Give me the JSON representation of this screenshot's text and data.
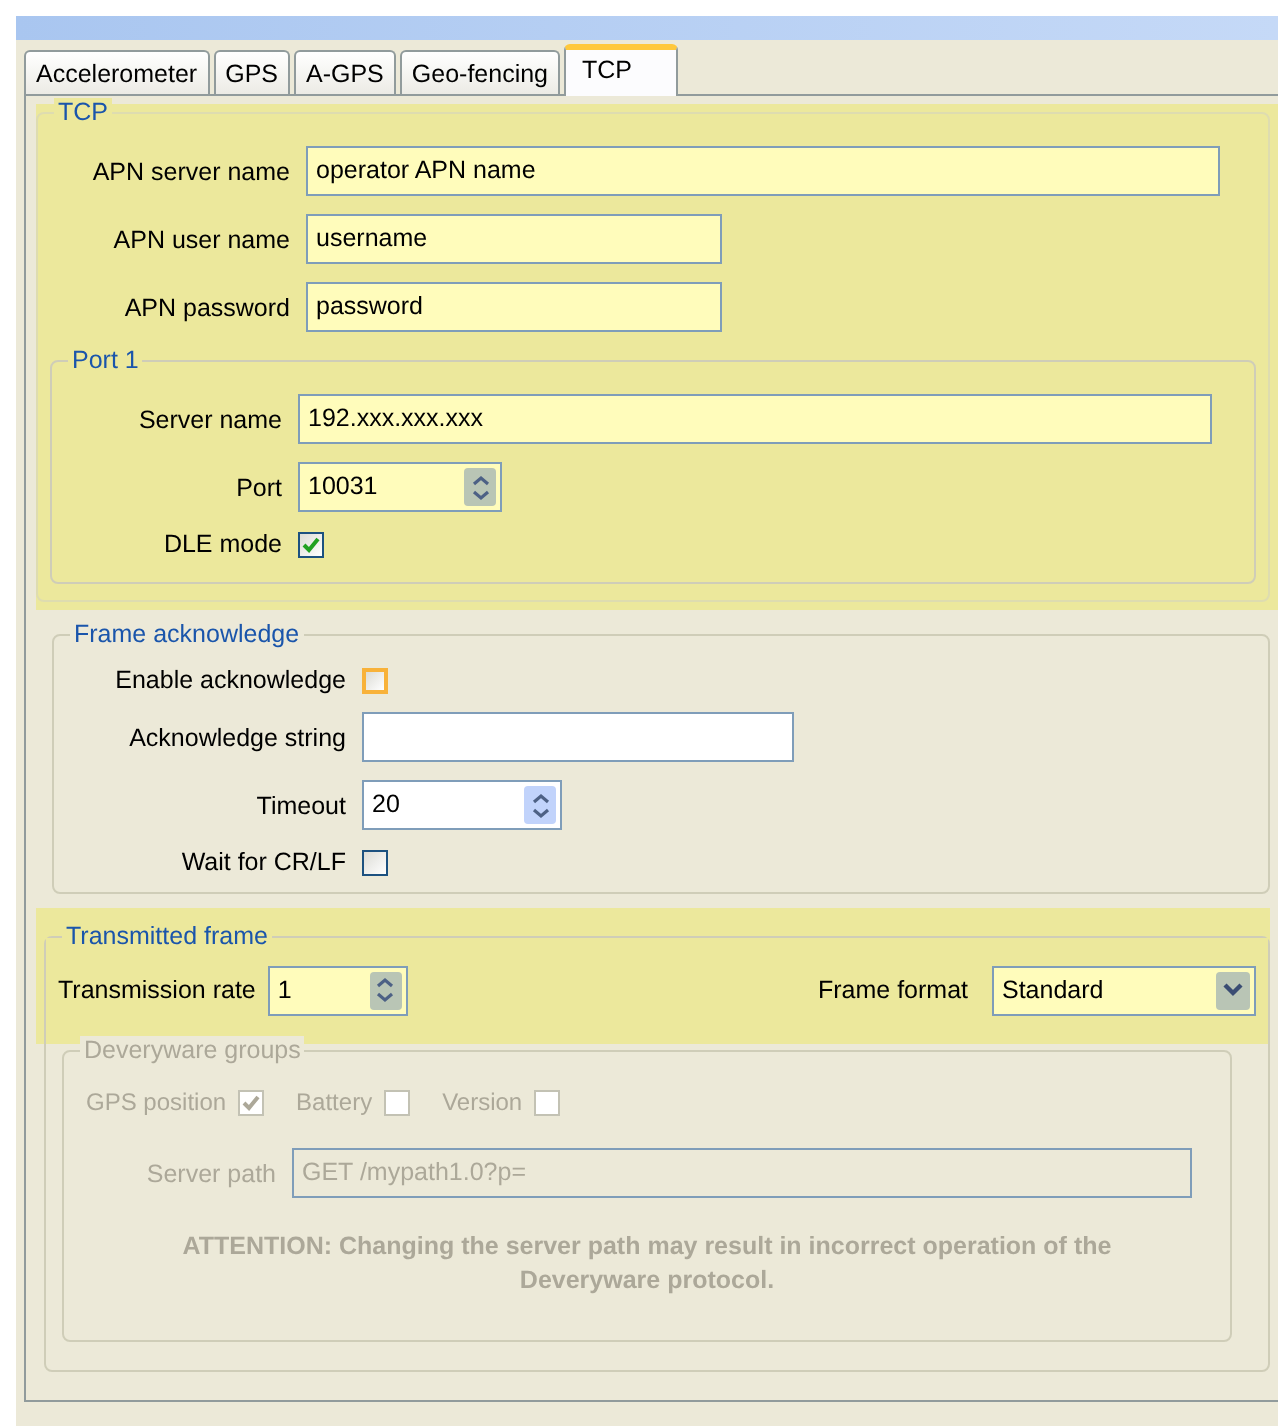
{
  "tabs": [
    {
      "label": "Accelerometer",
      "selected": false
    },
    {
      "label": "GPS",
      "selected": false
    },
    {
      "label": "A-GPS",
      "selected": false
    },
    {
      "label": "Geo-fencing",
      "selected": false
    },
    {
      "label": "TCP",
      "selected": true
    }
  ],
  "tcp": {
    "title": "TCP",
    "highlighted": true,
    "apn_server_name": {
      "label": "APN server name",
      "value": "operator APN name"
    },
    "apn_user_name": {
      "label": "APN user name",
      "value": "username"
    },
    "apn_password": {
      "label": "APN password",
      "value": "password"
    },
    "port_1": {
      "title": "Port 1",
      "server_name": {
        "label": "Server name",
        "value": "192.xxx.xxx.xxx"
      },
      "port": {
        "label": "Port",
        "value": "10031"
      },
      "dle_mode": {
        "label": "DLE mode",
        "checked": true
      }
    }
  },
  "frame_acknowledge": {
    "title": "Frame acknowledge",
    "highlighted": false,
    "enable_acknowledge": {
      "label": "Enable acknowledge",
      "checked": false,
      "hovered": true
    },
    "acknowledge_string": {
      "label": "Acknowledge string"
    },
    "timeout": {
      "label": "Timeout",
      "value": "20"
    },
    "wait_for_cr_lf": {
      "label": "Wait for CR/LF",
      "checked": false,
      "hovered": false
    }
  },
  "transmitted_frame": {
    "title": "Transmitted frame",
    "highlighted": true,
    "transmission_rate": {
      "label": "Transmission rate",
      "value": "1"
    },
    "frame_format": {
      "label": "Frame format",
      "value": "Standard"
    },
    "deveryware_groups": {
      "title": "Deveryware groups",
      "disabled": true,
      "checks": [
        {
          "label": "GPS position",
          "checked": true
        },
        {
          "label": "Battery",
          "checked": false
        },
        {
          "label": "Version",
          "checked": false
        }
      ],
      "server_path": {
        "label": "Server path",
        "value": "GET /mypath1.0?p="
      },
      "attention": "ATTENTION: Changing the server path may result in incorrect operation of the Deveryware protocol."
    }
  }
}
